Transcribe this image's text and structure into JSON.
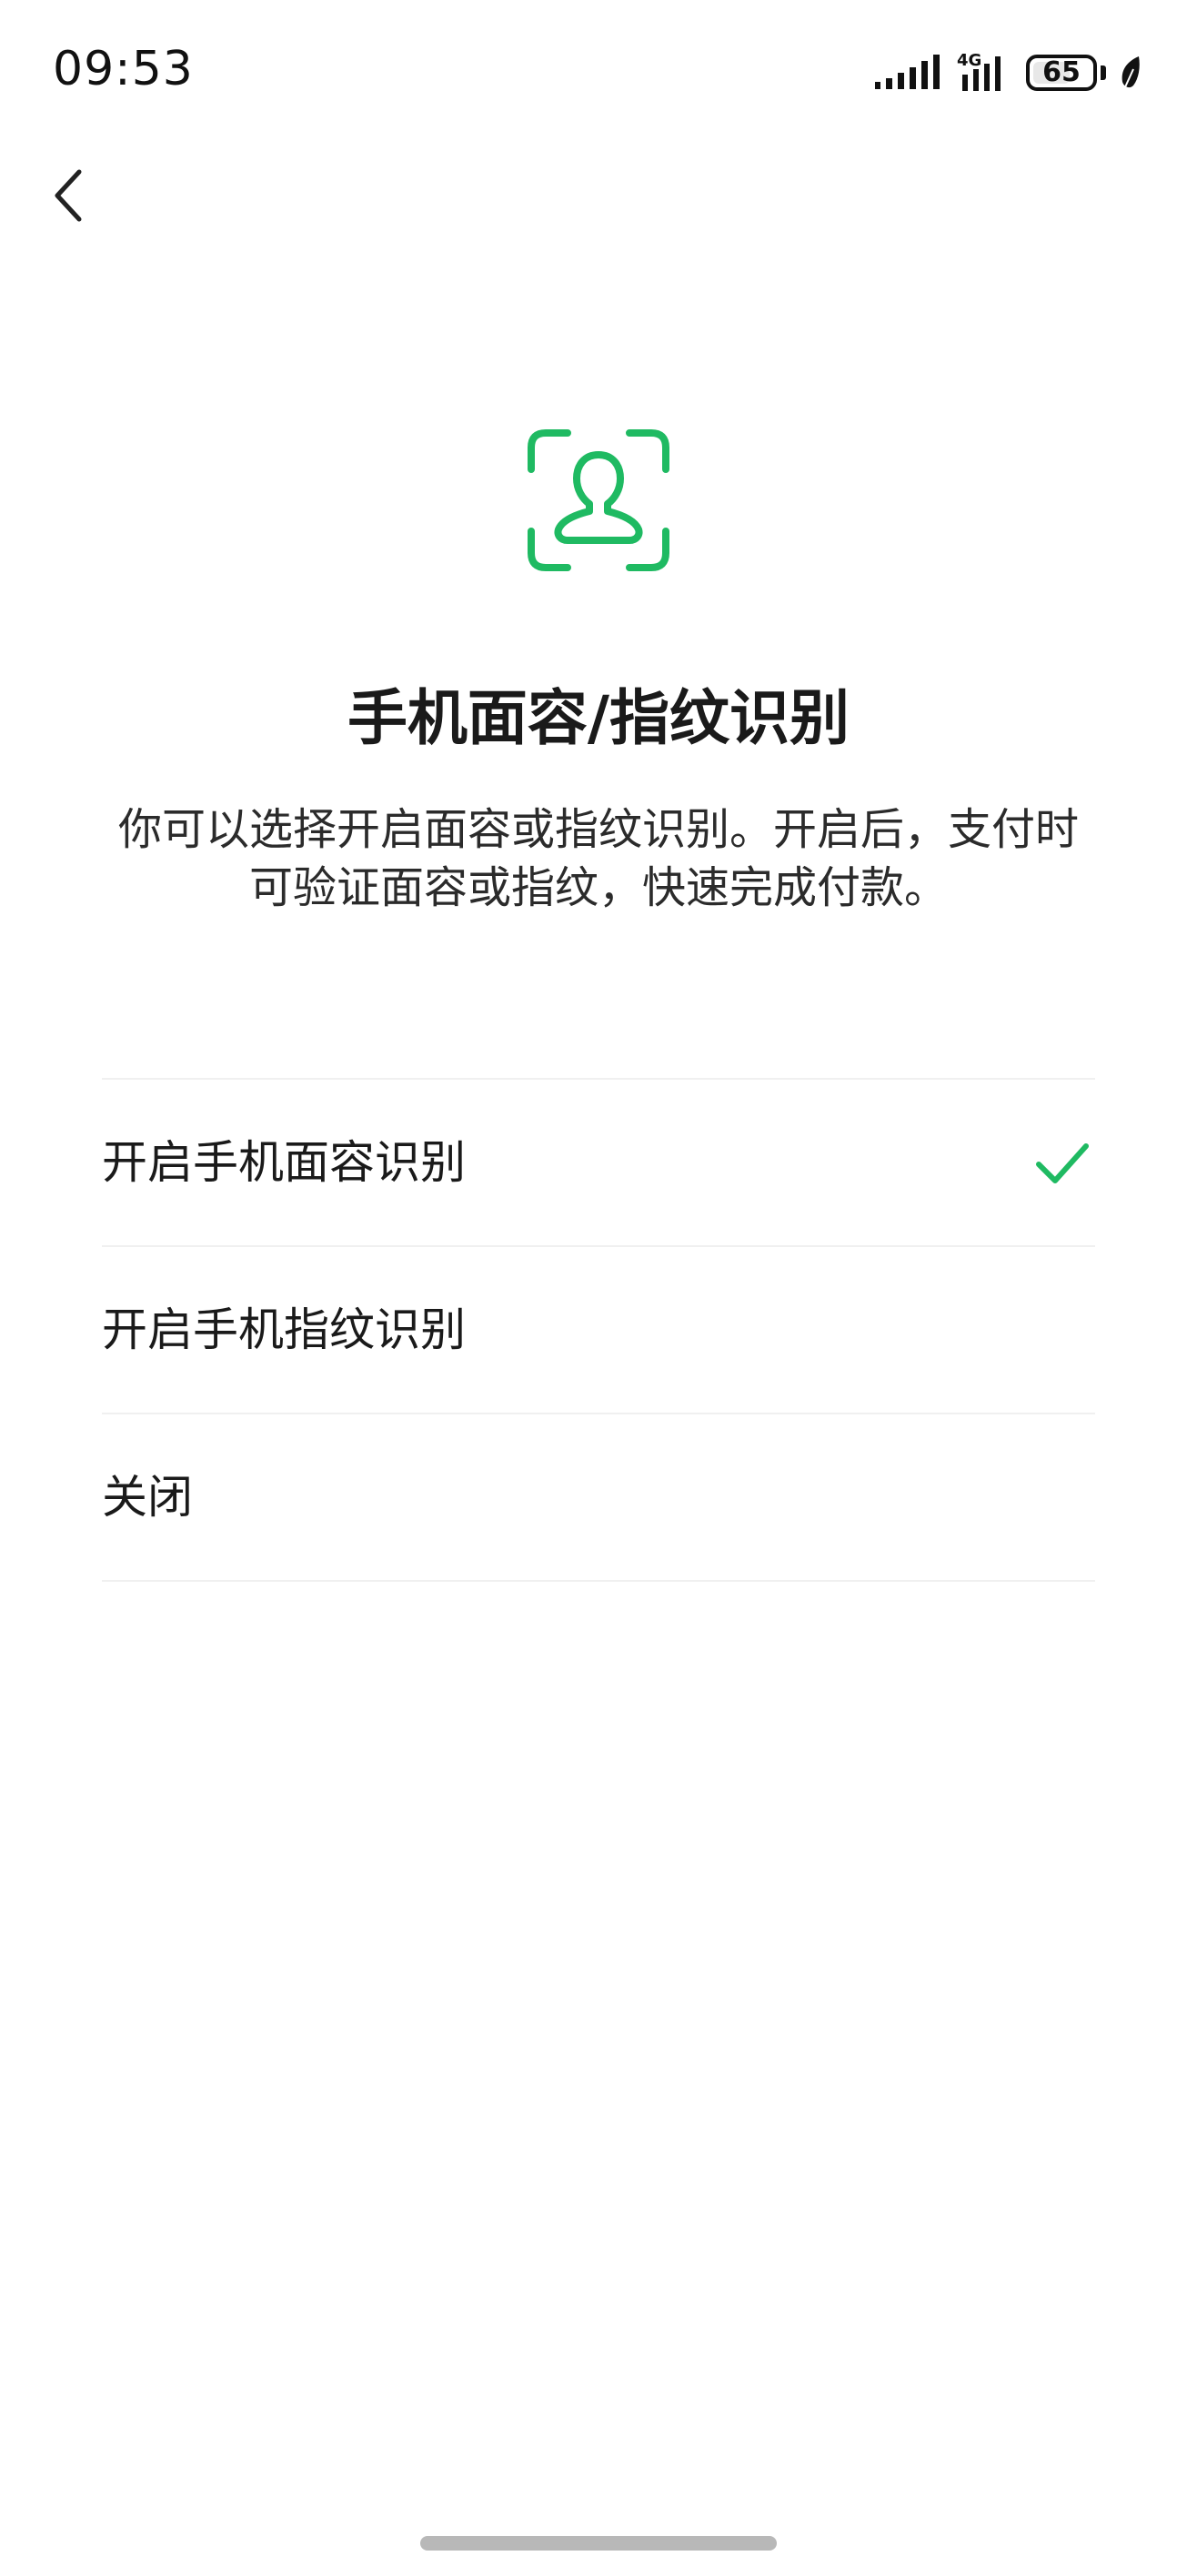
{
  "status_bar": {
    "time": "09:53",
    "network_label": "4G",
    "battery_level": "65",
    "battery_fraction": 0.65
  },
  "navigation": {
    "back_icon": "chevron-left-icon"
  },
  "header": {
    "icon": "face-recognition-icon",
    "title": "手机面容/指纹识别",
    "description": "你可以选择开启面容或指纹识别。开启后，支付时可验证面容或指纹，快速完成付款。"
  },
  "options": [
    {
      "label": "开启手机面容识别",
      "selected": true
    },
    {
      "label": "开启手机指纹识别",
      "selected": false
    },
    {
      "label": "关闭",
      "selected": false
    }
  ],
  "colors": {
    "accent": "#1fba62",
    "text": "#1a1a1a",
    "divider": "#f0f0f0"
  }
}
